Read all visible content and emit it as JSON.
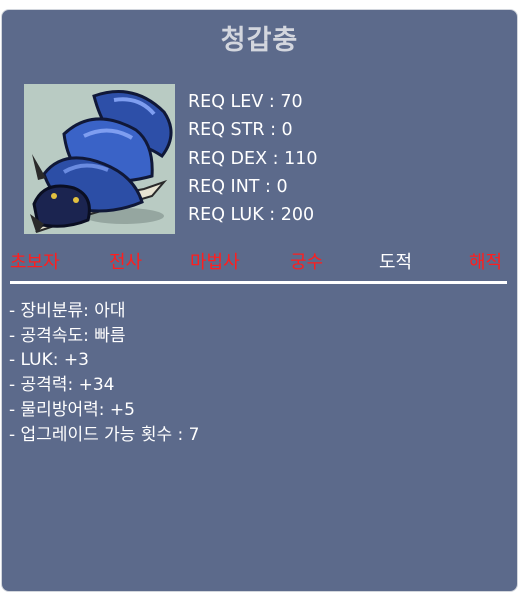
{
  "item": {
    "name": "청갑충",
    "image_icon": "blue-beetle-claw-icon"
  },
  "requirements": [
    "REQ LEV : 70",
    "REQ STR : 0",
    "REQ DEX : 110",
    "REQ INT : 0",
    "REQ LUK : 200"
  ],
  "jobs": [
    {
      "label": "초보자",
      "color": "#ff1e1e"
    },
    {
      "label": "전사",
      "color": "#ff1e1e"
    },
    {
      "label": "마법사",
      "color": "#ff1e1e"
    },
    {
      "label": "궁수",
      "color": "#ff1e1e"
    },
    {
      "label": "도적",
      "color": "#ffffff"
    },
    {
      "label": "해적",
      "color": "#ff1e1e"
    }
  ],
  "stats": [
    "- 장비분류: 아대",
    "- 공격속도: 빠름",
    "- LUK: +3",
    "- 공격력: +34",
    "- 물리방어력: +5",
    "- 업그레이드 가능 횟수 : 7"
  ],
  "colors": {
    "card_bg": "#5c6a8b",
    "title": "#d3d6de",
    "job_unavailable": "#ff1e1e",
    "job_available": "#ffffff"
  }
}
